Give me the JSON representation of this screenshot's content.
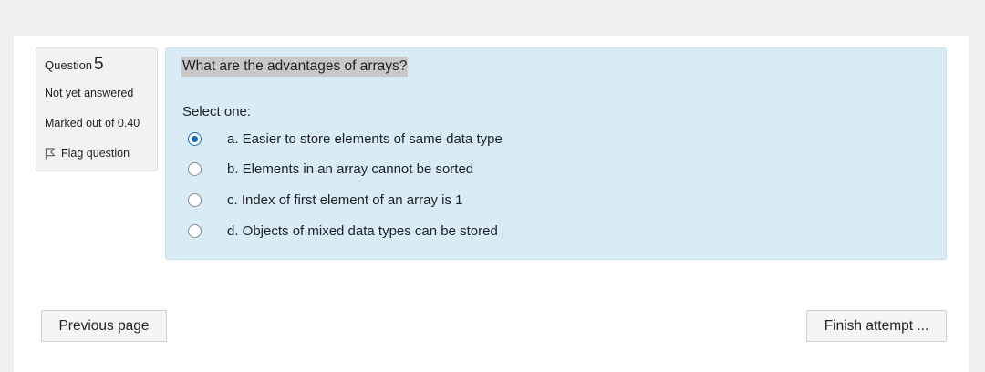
{
  "question_info": {
    "label": "Question",
    "number": "5",
    "state": "Not yet answered",
    "grade": "Marked out of 0.40",
    "flag_label": "Flag question"
  },
  "question": {
    "text": "What are the advantages of arrays?",
    "prompt": "Select one:",
    "options": [
      {
        "label": "a. Easier to store elements of same data type",
        "selected": true
      },
      {
        "label": "b. Elements in an array cannot be sorted",
        "selected": false
      },
      {
        "label": "c. Index of first element of an array is 1",
        "selected": false
      },
      {
        "label": "d. Objects of mixed data types can be stored",
        "selected": false
      }
    ]
  },
  "navigation": {
    "previous_label": "Previous page",
    "finish_label": "Finish attempt ..."
  },
  "colors": {
    "content_bg": "#d9ecf5",
    "radio_selected": "#0f6cbf",
    "info_bg": "#f2f2f2"
  },
  "icons": {
    "flag": "flag-icon"
  }
}
